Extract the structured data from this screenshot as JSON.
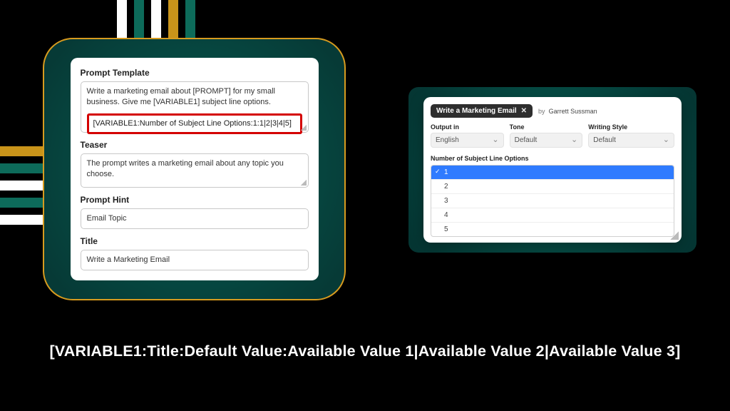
{
  "left_panel": {
    "prompt_template_label": "Prompt Template",
    "prompt_body": "Write a marketing email about [PROMPT] for my small business. Give me [VARIABLE1] subject line options.",
    "variable_def": "[VARIABLE1:Number of Subject Line Options:1:1|2|3|4|5]",
    "teaser_label": "Teaser",
    "teaser_body": "The prompt writes a marketing email about any topic you choose.",
    "hint_label": "Prompt Hint",
    "hint_value": "Email Topic",
    "title_label": "Title",
    "title_value": "Write a Marketing Email"
  },
  "right_panel": {
    "chip_label": "Write a Marketing Email",
    "chip_close": "✕",
    "by_prefix": "by",
    "by_name": "Garrett Sussman",
    "selects": {
      "output_label": "Output in",
      "output_value": "English",
      "tone_label": "Tone",
      "tone_value": "Default",
      "style_label": "Writing Style",
      "style_value": "Default"
    },
    "dd_label": "Number of Subject Line Options",
    "dd_items": [
      "1",
      "2",
      "3",
      "4",
      "5"
    ],
    "dd_selected_index": 0
  },
  "syntax_line": "[VARIABLE1:Title:Default Value:Available Value 1|Available Value 2|Available Value 3]"
}
